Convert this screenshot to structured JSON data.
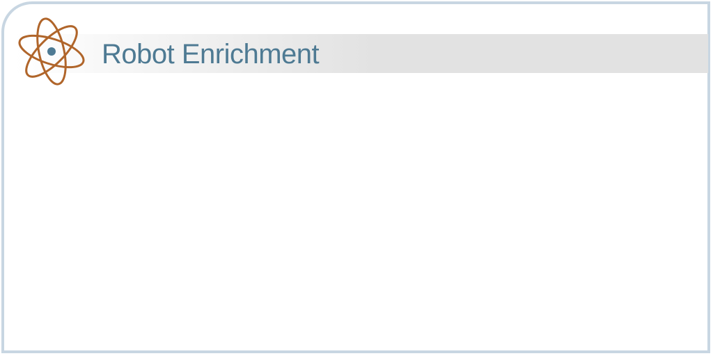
{
  "page": {
    "title": "Robot Enrichment",
    "icon": "atom-icon",
    "colors": {
      "title": "#4e7a93",
      "icon": "#b0652a",
      "icon_nucleus": "#4e7a93",
      "frame_border": "#c8d6e2",
      "header_band": "#e2e2e2"
    }
  }
}
